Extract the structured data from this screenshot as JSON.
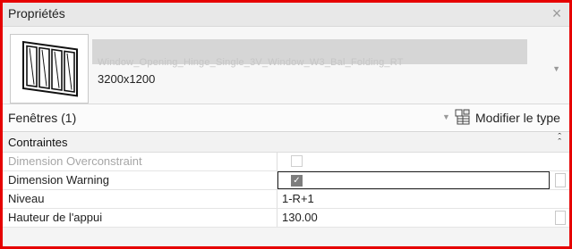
{
  "panel": {
    "title": "Propriétés"
  },
  "type_selector": {
    "type_name": "Window_Opening_Hinge_Single_3V_Window_W3_Bal_Folding_RT",
    "size": "3200x1200"
  },
  "filter": {
    "instance_label": "Fenêtres (1)",
    "edit_type_label": "Modifier le type"
  },
  "group": {
    "label": "Contraintes"
  },
  "rows": [
    {
      "name": "Dimension Overconstraint",
      "kind": "checkbox",
      "checked": false,
      "enabled": false
    },
    {
      "name": "Dimension Warning",
      "kind": "checkbox",
      "checked": true,
      "enabled": true,
      "active": true
    },
    {
      "name": "Niveau",
      "kind": "text",
      "value": "1-R+1",
      "enabled": true
    },
    {
      "name": "Hauteur de l'appui",
      "kind": "text",
      "value": "130.00",
      "enabled": true
    }
  ],
  "icons": {
    "close": "close-icon",
    "window_thumb": "window-thumbnail-icon",
    "edit_type": "edit-type-icon",
    "collapse": "collapse-chevrons-icon",
    "dropdown": "dropdown-arrow-icon"
  }
}
